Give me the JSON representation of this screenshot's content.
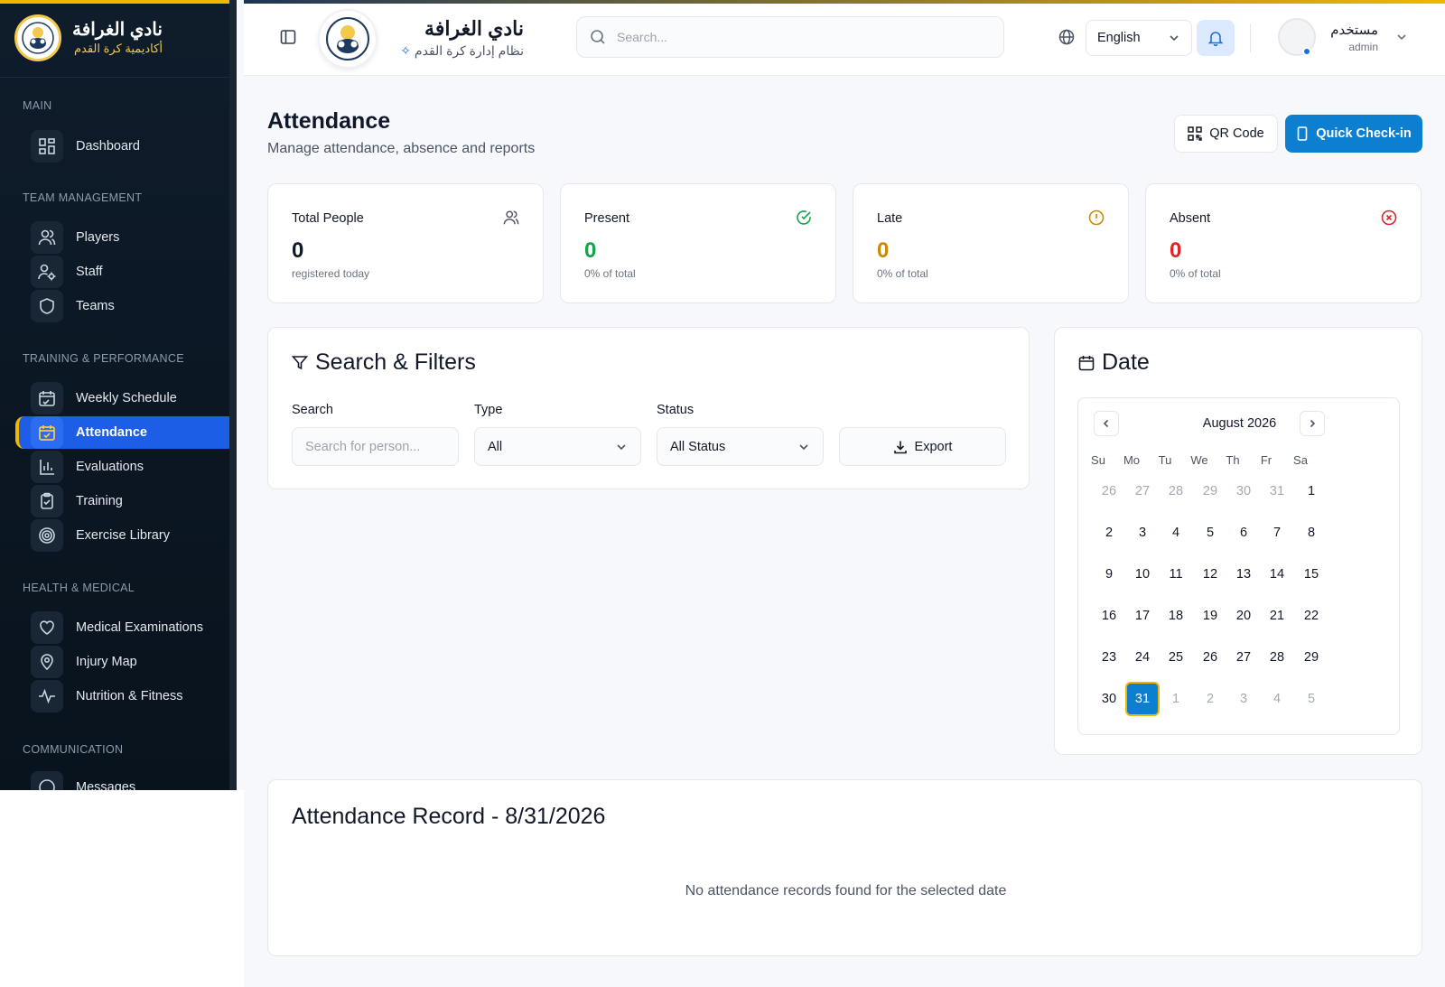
{
  "brand": {
    "name": "نادي الغرافة",
    "subtitle": "أكاديمية كرة القدم"
  },
  "sidebar": {
    "sections": [
      {
        "title": "MAIN",
        "items": [
          {
            "label": "Dashboard",
            "icon": "grid-icon"
          }
        ]
      },
      {
        "title": "TEAM MANAGEMENT",
        "items": [
          {
            "label": "Players",
            "icon": "users-icon"
          },
          {
            "label": "Staff",
            "icon": "user-cog-icon"
          },
          {
            "label": "Teams",
            "icon": "shield-icon"
          }
        ]
      },
      {
        "title": "TRAINING & PERFORMANCE",
        "items": [
          {
            "label": "Weekly Schedule",
            "icon": "calendar-icon"
          },
          {
            "label": "Attendance",
            "icon": "calendar-check-icon",
            "active": true
          },
          {
            "label": "Evaluations",
            "icon": "bar-chart-icon"
          },
          {
            "label": "Training",
            "icon": "clipboard-check-icon"
          },
          {
            "label": "Exercise Library",
            "icon": "target-icon"
          }
        ]
      },
      {
        "title": "HEALTH & MEDICAL",
        "items": [
          {
            "label": "Medical Examinations",
            "icon": "heart-icon"
          },
          {
            "label": "Injury Map",
            "icon": "map-pin-icon"
          },
          {
            "label": "Nutrition & Fitness",
            "icon": "activity-icon"
          }
        ]
      },
      {
        "title": "COMMUNICATION",
        "items": [
          {
            "label": "Messages",
            "icon": "message-icon"
          }
        ]
      }
    ]
  },
  "header": {
    "club_name": "نادي الغرافة",
    "club_subtitle": "نظام إدارة كرة القدم",
    "search_placeholder": "Search...",
    "language": "English",
    "user_name": "مستخدم",
    "user_role": "admin"
  },
  "page": {
    "title": "Attendance",
    "subtitle": "Manage attendance, absence and reports",
    "qr_button": "QR Code",
    "quick_checkin_button": "Quick Check-in"
  },
  "stats": [
    {
      "label": "Total People",
      "value": "0",
      "note": "registered today",
      "color": "#111827",
      "icon": "users-icon"
    },
    {
      "label": "Present",
      "value": "0",
      "note": "0% of total",
      "color": "#16a34a",
      "icon": "check-circle-icon"
    },
    {
      "label": "Late",
      "value": "0",
      "note": "0% of total",
      "color": "#ca8a04",
      "icon": "alert-circle-icon"
    },
    {
      "label": "Absent",
      "value": "0",
      "note": "0% of total",
      "color": "#dc2626",
      "icon": "x-circle-icon"
    }
  ],
  "filters": {
    "title": "Search & Filters",
    "search_label": "Search",
    "search_placeholder": "Search for person...",
    "type_label": "Type",
    "type_value": "All",
    "status_label": "Status",
    "status_value": "All Status",
    "export_label": "Export"
  },
  "date_panel": {
    "title": "Date",
    "month": "August 2026",
    "weekdays": [
      "Su",
      "Mo",
      "Tu",
      "We",
      "Th",
      "Fr",
      "Sa"
    ],
    "weeks": [
      [
        "26",
        "27",
        "28",
        "29",
        "30",
        "31",
        "1"
      ],
      [
        "2",
        "3",
        "4",
        "5",
        "6",
        "7",
        "8"
      ],
      [
        "9",
        "10",
        "11",
        "12",
        "13",
        "14",
        "15"
      ],
      [
        "16",
        "17",
        "18",
        "19",
        "20",
        "21",
        "22"
      ],
      [
        "23",
        "24",
        "25",
        "26",
        "27",
        "28",
        "29"
      ],
      [
        "30",
        "31",
        "1",
        "2",
        "3",
        "4",
        "5"
      ]
    ],
    "outside_days_first_row": 6,
    "outside_days_last_row": 5,
    "selected_day": "31"
  },
  "record": {
    "title": "Attendance Record - 8/31/2026",
    "empty_message": "No attendance records found for the selected date"
  },
  "colors": {
    "accent": "#0d7fd0",
    "sidebar_active": "#1d5ee6",
    "gold": "#f2b705"
  }
}
